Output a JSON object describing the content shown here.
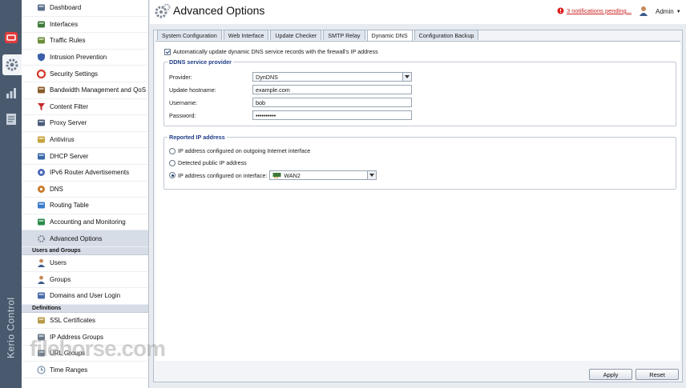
{
  "app": {
    "brand": "Kerio Control",
    "title": "Advanced Options"
  },
  "header": {
    "notifications_label": "3 notifications pending...",
    "user_label": "Admin"
  },
  "rail": {
    "items": [
      {
        "name": "Kerio logo",
        "icon": "kerio-logo-icon"
      },
      {
        "name": "Configuration",
        "icon": "gear-icon"
      },
      {
        "name": "Status",
        "icon": "bar-chart-icon"
      },
      {
        "name": "Logs",
        "icon": "document-icon"
      }
    ]
  },
  "sidebar": {
    "items": [
      {
        "label": "Dashboard",
        "icon": "dashboard-icon"
      },
      {
        "label": "Interfaces",
        "icon": "network-card-icon"
      },
      {
        "label": "Traffic Rules",
        "icon": "traffic-rules-icon"
      },
      {
        "label": "Intrusion Prevention",
        "icon": "shield-icon"
      },
      {
        "label": "Security Settings",
        "icon": "lifebuoy-icon"
      },
      {
        "label": "Bandwidth Management and QoS",
        "icon": "pipes-icon"
      },
      {
        "label": "Content Filter",
        "icon": "filter-icon"
      },
      {
        "label": "Proxy Server",
        "icon": "proxy-icon"
      },
      {
        "label": "Antivirus",
        "icon": "antivirus-icon"
      },
      {
        "label": "DHCP Server",
        "icon": "dhcp-icon"
      },
      {
        "label": "IPv6 Router Advertisements",
        "icon": "ipv6-icon"
      },
      {
        "label": "DNS",
        "icon": "dns-icon"
      },
      {
        "label": "Routing Table",
        "icon": "routing-icon"
      },
      {
        "label": "Accounting and Monitoring",
        "icon": "monitoring-icon"
      },
      {
        "label": "Advanced Options",
        "icon": "advanced-gear-icon"
      }
    ],
    "section_users": "Users and Groups",
    "users_items": [
      {
        "label": "Users",
        "icon": "user-icon"
      },
      {
        "label": "Groups",
        "icon": "group-icon"
      },
      {
        "label": "Domains and User Login",
        "icon": "domain-icon"
      }
    ],
    "section_definitions": "Definitions",
    "definitions_items": [
      {
        "label": "SSL Certificates",
        "icon": "certificate-icon"
      },
      {
        "label": "IP Address Groups",
        "icon": "ip-group-icon"
      },
      {
        "label": "URL Groups",
        "icon": "url-group-icon"
      },
      {
        "label": "Time Ranges",
        "icon": "clock-icon"
      }
    ]
  },
  "tabs": [
    {
      "label": "System Configuration"
    },
    {
      "label": "Web Interface"
    },
    {
      "label": "Update Checker"
    },
    {
      "label": "SMTP Relay"
    },
    {
      "label": "Dynamic DNS"
    },
    {
      "label": "Configuration Backup"
    }
  ],
  "ddns": {
    "auto_update_label": "Automatically update dynamic DNS service records with the firewall's IP address",
    "auto_update_checked": true,
    "provider_group_title": "DDNS service provider",
    "provider_label": "Provider:",
    "provider_value": "DynDNS",
    "hostname_label": "Update hostname:",
    "hostname_value": "example.com",
    "username_label": "Username:",
    "username_value": "bob",
    "password_label": "Password:",
    "password_value": "••••••••••",
    "reported_group_title": "Reported IP address",
    "option_outgoing": "IP address configured on outgoing Internet interface",
    "option_detected": "Detected public IP address",
    "option_interface": "IP address configured on interface:",
    "interface_value": "WAN2",
    "selected_option": "interface"
  },
  "footer": {
    "apply_label": "Apply",
    "reset_label": "Reset"
  },
  "watermark": "filehorse.com",
  "colors": {
    "rail": "#4a5a6e",
    "accent_title": "#1f3c88",
    "notification": "#cc2222"
  }
}
